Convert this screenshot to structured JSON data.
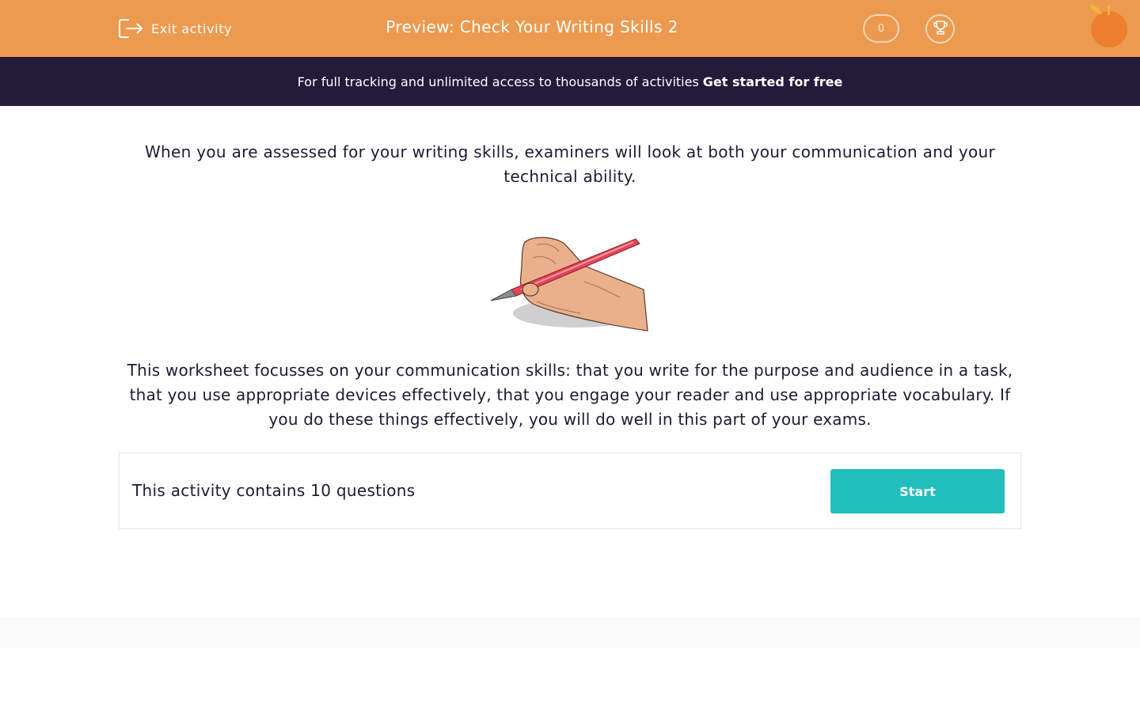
{
  "header": {
    "exit_label": "Exit activity",
    "title": "Preview: Check Your Writing Skills 2",
    "score": "0",
    "icons": [
      "exit-icon",
      "trophy-icon",
      "logo-orange"
    ]
  },
  "banner": {
    "text": "For full tracking and unlimited access to thousands of activities",
    "cta": "Get started for free"
  },
  "content": {
    "intro": "When you are assessed for your writing skills, examiners will look at both your communication and your technical ability.",
    "illustration_icon": "hand-writing-with-pen",
    "body": "This worksheet focusses on your communication skills: that you write for the purpose and audience in a task, that you use appropriate devices effectively, that you engage your reader and use appropriate vocabulary. If you do these things effectively, you will do well in this part of your exams."
  },
  "card": {
    "count_text": "This activity contains 10 questions",
    "start_label": "Start"
  },
  "colors": {
    "header_bg": "#ec9a50",
    "banner_bg": "#241a3a",
    "accent": "#22bdbd",
    "text": "#1f1a33"
  }
}
